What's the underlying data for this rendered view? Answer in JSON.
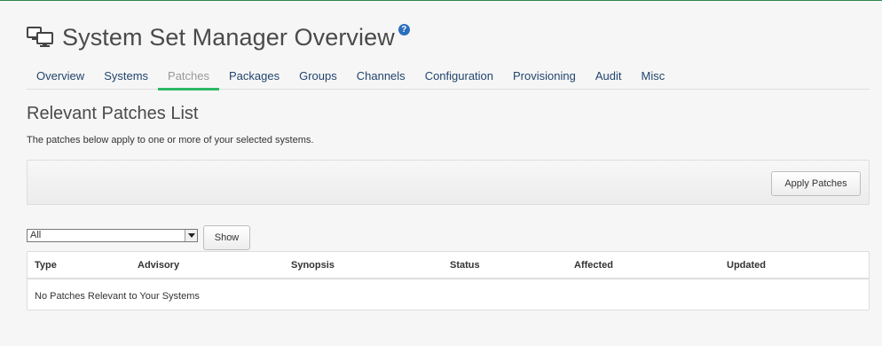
{
  "header": {
    "title": "System Set Manager Overview",
    "icon": "desktop-icon",
    "help_icon": "help-icon",
    "help_glyph": "?"
  },
  "tabs": [
    {
      "label": "Overview",
      "active": false
    },
    {
      "label": "Systems",
      "active": false
    },
    {
      "label": "Patches",
      "active": true
    },
    {
      "label": "Packages",
      "active": false
    },
    {
      "label": "Groups",
      "active": false
    },
    {
      "label": "Channels",
      "active": false
    },
    {
      "label": "Configuration",
      "active": false
    },
    {
      "label": "Provisioning",
      "active": false
    },
    {
      "label": "Audit",
      "active": false
    },
    {
      "label": "Misc",
      "active": false
    }
  ],
  "section": {
    "title": "Relevant Patches List",
    "description": "The patches below apply to one or more of your selected systems."
  },
  "toolbar": {
    "apply_label": "Apply Patches"
  },
  "filter": {
    "selected": "All",
    "show_label": "Show"
  },
  "table": {
    "columns": [
      "Type",
      "Advisory",
      "Synopsis",
      "Status",
      "Affected",
      "Updated"
    ],
    "empty_message": "No Patches Relevant to Your Systems"
  },
  "colors": {
    "accent": "#2fb864",
    "link": "#22456d",
    "help": "#2a6fbf"
  }
}
